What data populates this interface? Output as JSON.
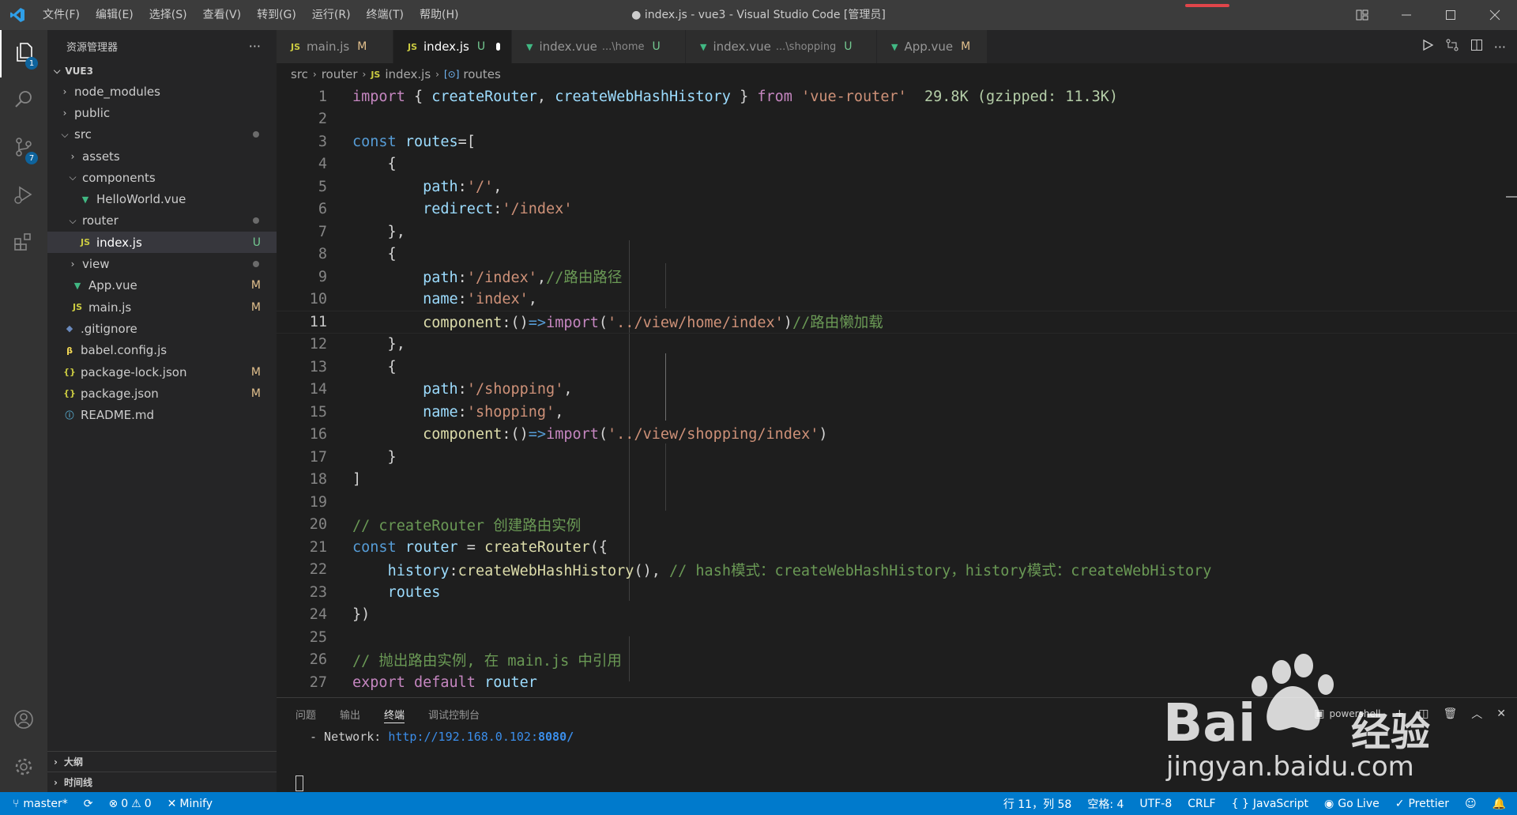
{
  "titlebar": {
    "menu": [
      "文件(F)",
      "编辑(E)",
      "选择(S)",
      "查看(V)",
      "转到(G)",
      "运行(R)",
      "终端(T)",
      "帮助(H)"
    ],
    "window_title": "● index.js - vue3 - Visual Studio Code [管理员]"
  },
  "activitybar": {
    "explorer_badge": "1",
    "scm_badge": "7"
  },
  "sidebar": {
    "title": "资源管理器",
    "more": "···",
    "section": "VUE3",
    "tree": [
      {
        "label": "node_modules",
        "status": ""
      },
      {
        "label": "public",
        "status": ""
      },
      {
        "label": "src",
        "status": ""
      },
      {
        "label": "assets",
        "status": ""
      },
      {
        "label": "components",
        "status": ""
      },
      {
        "label": "HelloWorld.vue",
        "status": ""
      },
      {
        "label": "router",
        "status": ""
      },
      {
        "label": "index.js",
        "status": "U"
      },
      {
        "label": "view",
        "status": ""
      },
      {
        "label": "App.vue",
        "status": "M"
      },
      {
        "label": "main.js",
        "status": "M"
      },
      {
        "label": ".gitignore",
        "status": ""
      },
      {
        "label": "babel.config.js",
        "status": ""
      },
      {
        "label": "package-lock.json",
        "status": "M"
      },
      {
        "label": "package.json",
        "status": "M"
      },
      {
        "label": "README.md",
        "status": ""
      }
    ],
    "outline": "大纲",
    "timeline": "时间线"
  },
  "tabs": [
    {
      "icon": "JS",
      "label": "main.js",
      "desc": "",
      "status": "M"
    },
    {
      "icon": "JS",
      "label": "index.js",
      "desc": "",
      "status": "U"
    },
    {
      "icon": "V",
      "label": "index.vue",
      "desc": "...\\home",
      "status": "U"
    },
    {
      "icon": "V",
      "label": "index.vue",
      "desc": "...\\shopping",
      "status": "U"
    },
    {
      "icon": "V",
      "label": "App.vue",
      "desc": "",
      "status": "M"
    }
  ],
  "breadcrumb": {
    "items": [
      "src",
      "router",
      "index.js",
      "routes"
    ]
  },
  "editor": {
    "line_numbers": [
      "1",
      "2",
      "3",
      "4",
      "5",
      "6",
      "7",
      "8",
      "9",
      "10",
      "11",
      "12",
      "13",
      "14",
      "15",
      "16",
      "17",
      "18",
      "19",
      "20",
      "21",
      "22",
      "23",
      "24",
      "25",
      "26",
      "27"
    ],
    "current_line": 11,
    "import_cost": "29.8K (gzipped: 11.3K)"
  },
  "panel": {
    "tabs": [
      "问题",
      "输出",
      "终端",
      "调试控制台"
    ],
    "shell": "powershell",
    "terminal_prefix": "- Network: ",
    "terminal_url": "http://192.168.0.102:",
    "terminal_port": "8080/"
  },
  "statusbar": {
    "branch": "master*",
    "errors": "0",
    "warnings": "0",
    "minify": "Minify",
    "position": "行 11，列 58",
    "spaces": "空格: 4",
    "encoding": "UTF-8",
    "eol": "CRLF",
    "language": "JavaScript",
    "golive": "Go Live",
    "prettier": "Prettier"
  },
  "watermark": {
    "brand": "Bai",
    "brand2": "经验",
    "url": "jingyan.baidu.com"
  }
}
